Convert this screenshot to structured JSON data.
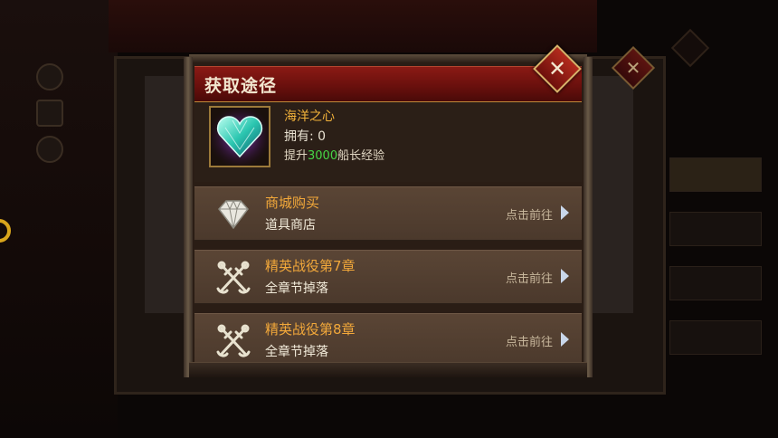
{
  "dialog": {
    "title": "获取途径"
  },
  "item": {
    "name": "海洋之心",
    "owned_label": "拥有: 0",
    "desc_prefix": "提升",
    "desc_value": "3000",
    "desc_suffix": "船长经验"
  },
  "sources": [
    {
      "title": "商城购买",
      "subtitle": "道具商店",
      "action": "点击前往",
      "icon": "diamond-icon"
    },
    {
      "title": "精英战役第7章",
      "subtitle": "全章节掉落",
      "action": "点击前往",
      "icon": "crossed-anchors-icon"
    },
    {
      "title": "精英战役第8章",
      "subtitle": "全章节掉落",
      "action": "点击前往",
      "icon": "crossed-anchors-icon"
    }
  ],
  "background": {
    "close_glyph": "✕"
  },
  "colors": {
    "title_bar": "#8a1a14",
    "item_name": "#f2b23a",
    "exp_value": "#46d646",
    "row_title": "#f2a83a",
    "arrow": "#c9d7ea"
  }
}
